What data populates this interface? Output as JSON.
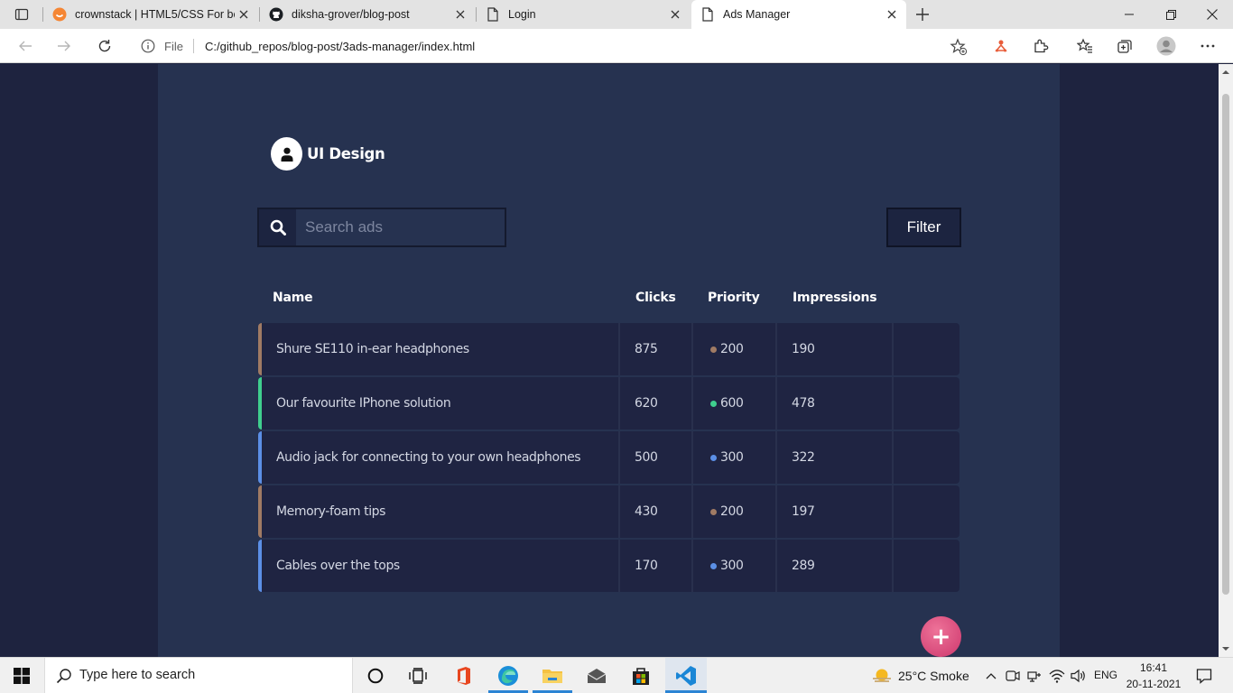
{
  "browser": {
    "tabs": [
      {
        "title": "crownstack | HTML5/CSS For beginners",
        "icon": "crownstack-favicon"
      },
      {
        "title": "diksha-grover/blog-post",
        "icon": "github-icon"
      },
      {
        "title": "Login",
        "icon": "page-icon"
      },
      {
        "title": "Ads Manager",
        "icon": "page-icon",
        "active": true
      }
    ],
    "address": {
      "scheme_label": "File",
      "url": "C:/github_repos/blog-post/3ads-manager/index.html"
    }
  },
  "app": {
    "brand": "UI Design",
    "search_placeholder": "Search ads",
    "filter_label": "Filter",
    "add_label": "+",
    "columns": {
      "name": "Name",
      "clicks": "Clicks",
      "priority": "Priority",
      "impressions": "Impressions"
    },
    "rows": [
      {
        "name": "Shure SE110 in-ear headphones",
        "clicks": "875",
        "priority": "200",
        "impressions": "190",
        "color": "#a07b64"
      },
      {
        "name": "Our favourite IPhone solution",
        "clicks": "620",
        "priority": "600",
        "impressions": "478",
        "color": "#3fcf8e"
      },
      {
        "name": "Audio jack for connecting to your own headphones",
        "clicks": "500",
        "priority": "300",
        "impressions": "322",
        "color": "#5b8fe6"
      },
      {
        "name": "Memory-foam tips",
        "clicks": "430",
        "priority": "200",
        "impressions": "197",
        "color": "#a07b64"
      },
      {
        "name": "Cables over the tops",
        "clicks": "170",
        "priority": "300",
        "impressions": "289",
        "color": "#5b8fe6"
      }
    ]
  },
  "taskbar": {
    "search_placeholder": "Type here to search",
    "weather": "25°C  Smoke",
    "language": "ENG",
    "time": "16:41",
    "date": "20-11-2021"
  },
  "colors": {
    "page_bg": "#1e233f",
    "panel_bg": "#263250",
    "row_bg": "#1f2442",
    "fab": "#d7497a"
  }
}
